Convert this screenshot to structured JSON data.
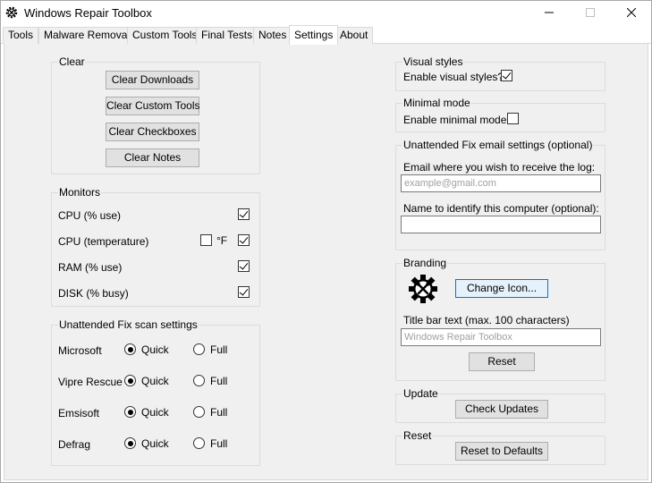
{
  "window": {
    "title": "Windows Repair Toolbox",
    "icon": "gear-wrench-icon"
  },
  "tabs": [
    "Tools",
    "Malware Removal",
    "Custom Tools",
    "Final Tests",
    "Notes",
    "Settings",
    "About"
  ],
  "active_tab": "Settings",
  "clear": {
    "label": "Clear",
    "buttons": [
      "Clear Downloads",
      "Clear Custom Tools",
      "Clear Checkboxes",
      "Clear Notes"
    ]
  },
  "monitors": {
    "label": "Monitors",
    "cpu_use": {
      "label": "CPU (% use)",
      "checked": true
    },
    "cpu_temp": {
      "label": "CPU (temperature)",
      "checked": true,
      "fahrenheit_label": "°F",
      "fahrenheit_checked": false
    },
    "ram_use": {
      "label": "RAM (% use)",
      "checked": true
    },
    "disk_busy": {
      "label": "DISK (% busy)",
      "checked": true
    }
  },
  "scan": {
    "label": "Unattended Fix scan settings",
    "quick_label": "Quick",
    "full_label": "Full",
    "rows": [
      {
        "name": "Microsoft",
        "selected": "Quick"
      },
      {
        "name": "Vipre Rescue",
        "selected": "Quick"
      },
      {
        "name": "Emsisoft",
        "selected": "Quick"
      },
      {
        "name": "Defrag",
        "selected": "Quick"
      }
    ]
  },
  "visual_styles": {
    "label": "Visual styles",
    "option_label": "Enable visual styles?",
    "checked": true
  },
  "minimal_mode": {
    "label": "Minimal mode",
    "option_label": "Enable minimal mode?",
    "checked": false
  },
  "email": {
    "label": "Unattended Fix email settings (optional)",
    "email_label": "Email where you wish to receive the log:",
    "email_placeholder": "example@gmail.com",
    "name_label": "Name to identify this computer (optional):",
    "name_value": ""
  },
  "branding": {
    "label": "Branding",
    "icon": "gear-wrench-icon",
    "change_icon_button": "Change Icon...",
    "title_label": "Title bar text (max. 100 characters)",
    "title_placeholder": "Windows Repair Toolbox",
    "reset_button": "Reset"
  },
  "update": {
    "label": "Update",
    "button": "Check Updates"
  },
  "reset": {
    "label": "Reset",
    "button": "Reset to Defaults"
  }
}
